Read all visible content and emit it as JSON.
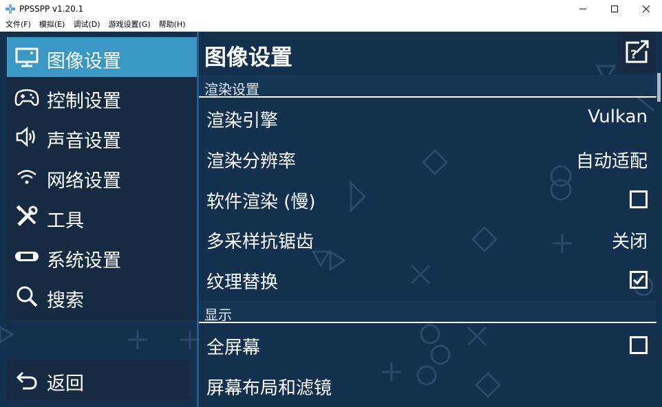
{
  "window": {
    "title": "PPSSPP v1.20.1",
    "menu": [
      "文件(F)",
      "模拟(E)",
      "调试(D)",
      "游戏设置(G)",
      "帮助(H)"
    ]
  },
  "sidebar": {
    "items": [
      {
        "label": "图像设置",
        "icon": "monitor-icon",
        "active": true
      },
      {
        "label": "控制设置",
        "icon": "gamepad-icon",
        "active": false
      },
      {
        "label": "声音设置",
        "icon": "speaker-icon",
        "active": false
      },
      {
        "label": "网络设置",
        "icon": "wifi-icon",
        "active": false
      },
      {
        "label": "工具",
        "icon": "tools-icon",
        "active": false
      },
      {
        "label": "系统设置",
        "icon": "psp-console-icon",
        "active": false
      },
      {
        "label": "搜索",
        "icon": "search-icon",
        "active": false
      }
    ],
    "back_label": "返回"
  },
  "panel": {
    "title": "图像设置",
    "sections": [
      {
        "header": "渲染设置",
        "rows": [
          {
            "label": "渲染引擎",
            "value": "Vulkan"
          },
          {
            "label": "渲染分辨率",
            "value": "自动适配"
          },
          {
            "label": "软件渲染 (慢)",
            "checkbox": false
          },
          {
            "label": "多采样抗锯齿",
            "value": "关闭"
          },
          {
            "label": "纹理替换",
            "checkbox": true
          }
        ]
      },
      {
        "header": "显示",
        "rows": [
          {
            "label": "全屏幕",
            "checkbox": false
          },
          {
            "label": "屏幕布局和滤镜"
          }
        ]
      }
    ]
  },
  "colors": {
    "background": "#13304f",
    "sidebar": "#162b41",
    "active": "#3b97c4",
    "section_header": "#163656"
  }
}
